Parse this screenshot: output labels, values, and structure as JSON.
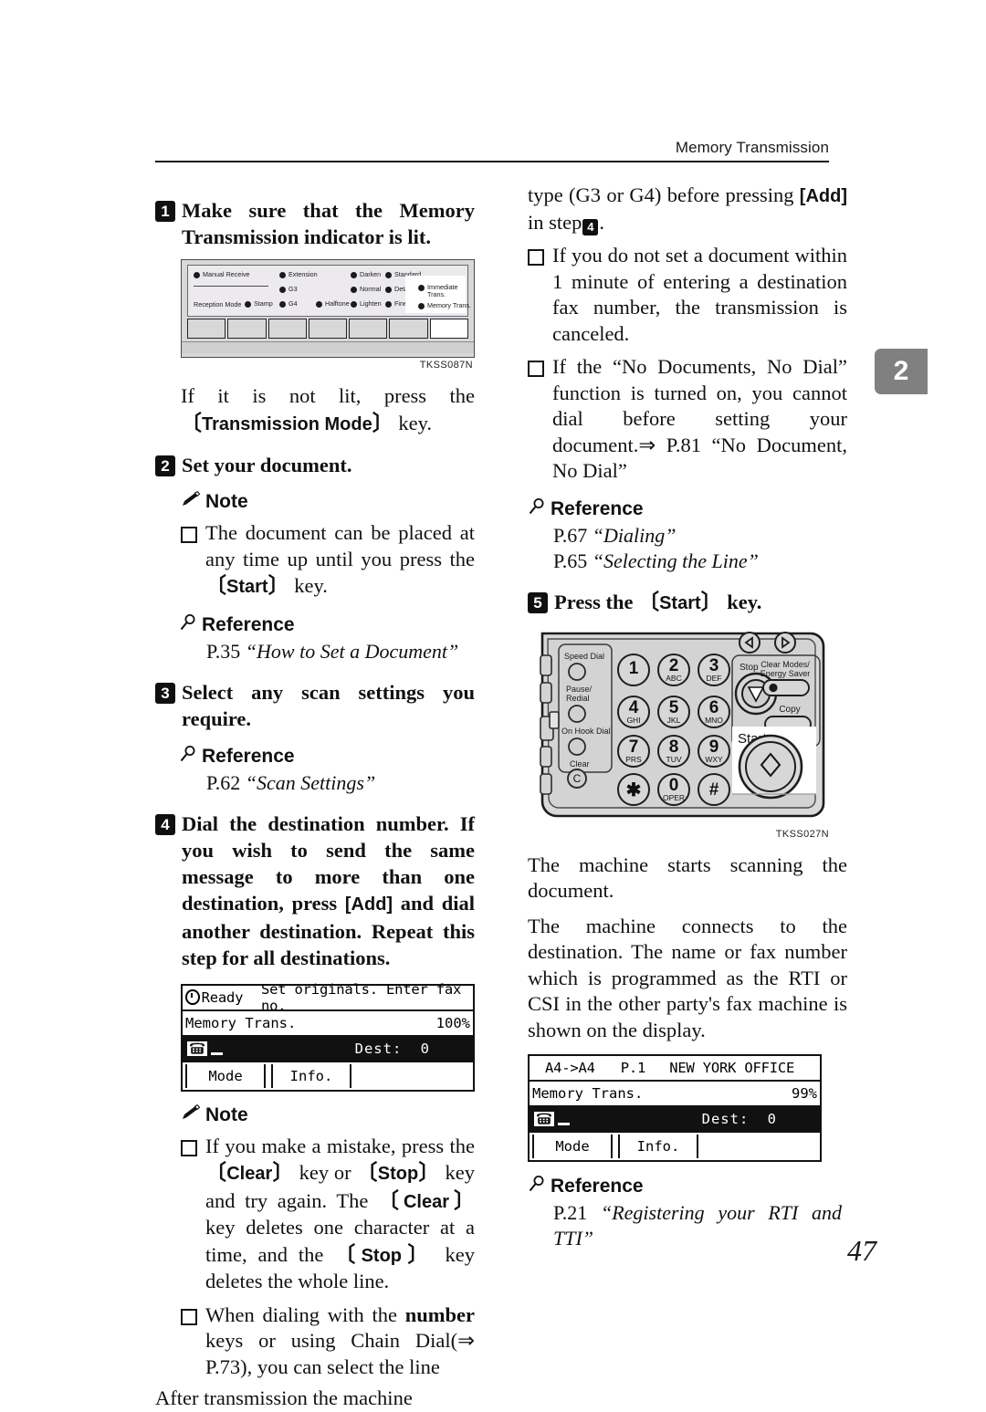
{
  "header": {
    "title": "Memory Transmission"
  },
  "chapter_tab": {
    "number": "2"
  },
  "page_number": "47",
  "left_column": {
    "step1": {
      "number": "1",
      "text": "Make sure that the Memory Transmission indicator is lit."
    },
    "figure_panel": {
      "code": "TKSS087N",
      "indicators": [
        "Manual Receive",
        "Reception Mode",
        "Stamp",
        "Extension",
        "G3",
        "G4",
        "Halftone",
        "Darken",
        "Normal",
        "Lighten",
        "Standard",
        "Detail",
        "Fine",
        "Immediate Trans.",
        "Memory Trans."
      ]
    },
    "after_figure": {
      "pre": "If it is not lit, press the",
      "key": "Transmission Mode",
      "post": "key."
    },
    "step2": {
      "number": "2",
      "text": "Set your document."
    },
    "note1": {
      "label": "Note",
      "items": [
        {
          "pre": "The document can be placed at any time up until you press the",
          "key": "Start",
          "post": "key."
        }
      ]
    },
    "reference1": {
      "label": "Reference",
      "lines": [
        {
          "page": "P.35",
          "title": "“How to Set a Document”"
        }
      ]
    },
    "step3": {
      "number": "3",
      "text": "Select any scan settings you require."
    },
    "reference2": {
      "label": "Reference",
      "lines": [
        {
          "page": "P.62",
          "title": "“Scan Settings”"
        }
      ]
    },
    "step4": {
      "number": "4",
      "pre": "Dial the destination number. If you wish to send the same message to more than one destination, press",
      "key": "[Add]",
      "post": "and dial another destination. Repeat this step for all destinations."
    },
    "lcd1": {
      "line1_status": "Ready",
      "line1_message": "Set originals. Enter fax no.",
      "line2_left": "Memory Trans.",
      "line2_right": "100%",
      "line3_label": "Dest:",
      "line3_value": "0",
      "softkey_left": "Mode",
      "softkey_right": "Info."
    },
    "note2": {
      "label": "Note",
      "items": [
        {
          "segments": [
            {
              "t": "If you make a mistake, press the "
            },
            {
              "t": "Clear",
              "style": "key"
            },
            {
              "t": " key or "
            },
            {
              "t": "Stop",
              "style": "key"
            },
            {
              "t": " key and try again. The "
            },
            {
              "t": "Clear",
              "style": "key"
            },
            {
              "t": " key deletes one character at a time, and the "
            },
            {
              "t": "Stop",
              "style": "key"
            },
            {
              "t": " key deletes the whole line."
            }
          ]
        },
        {
          "segments": [
            {
              "t": "When dialing with the "
            },
            {
              "t": "number",
              "style": "bold"
            },
            {
              "t": " keys or using Chain Dial(⇒ P.73), you can select the line"
            }
          ]
        }
      ]
    },
    "trailing_text": "After transmission the machine"
  },
  "right_column": {
    "continued": {
      "pre": "type (G3 or G4) before pressing",
      "key": "[Add]",
      "mid": "in step",
      "step_ref": "4",
      "post": "."
    },
    "bullets": [
      "If you do not set a document within 1 minute of entering a destination fax number, the transmission is canceled.",
      "If the “No Documents, No Dial” function is turned on, you cannot dial before setting your document.⇒ P.81 “No Document, No Dial”"
    ],
    "reference1": {
      "label": "Reference",
      "lines": [
        {
          "page": "P.67",
          "title": "“Dialing”"
        },
        {
          "page": "P.65",
          "title": "“Selecting the Line”"
        }
      ]
    },
    "step5": {
      "number": "5",
      "pre": "Press the",
      "key": "Start",
      "post": "key."
    },
    "figure_keypad": {
      "code": "TKSS027N",
      "labels": {
        "speed_dial": "Speed Dial",
        "pause_redial": "Pause/ Redial",
        "on_hook_dial": "On Hook Dial",
        "clear": "Clear",
        "clear_glyph": "C",
        "stop": "Stop",
        "clear_modes": "Clear Modes/ Energy Saver",
        "copy": "Copy",
        "start": "Start"
      },
      "keys": [
        {
          "digit": "1",
          "letters": ""
        },
        {
          "digit": "2",
          "letters": "ABC"
        },
        {
          "digit": "3",
          "letters": "DEF"
        },
        {
          "digit": "4",
          "letters": "GHI"
        },
        {
          "digit": "5",
          "letters": "JKL"
        },
        {
          "digit": "6",
          "letters": "MNO"
        },
        {
          "digit": "7",
          "letters": "PRS"
        },
        {
          "digit": "8",
          "letters": "TUV"
        },
        {
          "digit": "9",
          "letters": "WXY"
        },
        {
          "digit": "∗",
          "letters": ""
        },
        {
          "digit": "0",
          "letters": "OPER"
        },
        {
          "digit": "#",
          "letters": ""
        }
      ]
    },
    "para1": "The machine starts scanning the document.",
    "para2": "The machine connects to the destination. The name or fax number which is programmed as the RTI or CSI in the other party's fax machine is shown on the display.",
    "lcd2": {
      "line1_left": "A4->A4",
      "line1_mid": "P.1",
      "line1_right": "NEW YORK OFFICE",
      "line2_left": "Memory Trans.",
      "line2_right": "99%",
      "line3_label": "Dest:",
      "line3_value": "0",
      "softkey_left": "Mode",
      "softkey_right": "Info."
    },
    "reference2": {
      "label": "Reference",
      "lines": [
        {
          "page": "P.21",
          "title": "“Registering your RTI and TTI”"
        }
      ]
    }
  },
  "icons": {
    "note": "pencil-icon",
    "reference": "magnifier-icon"
  }
}
